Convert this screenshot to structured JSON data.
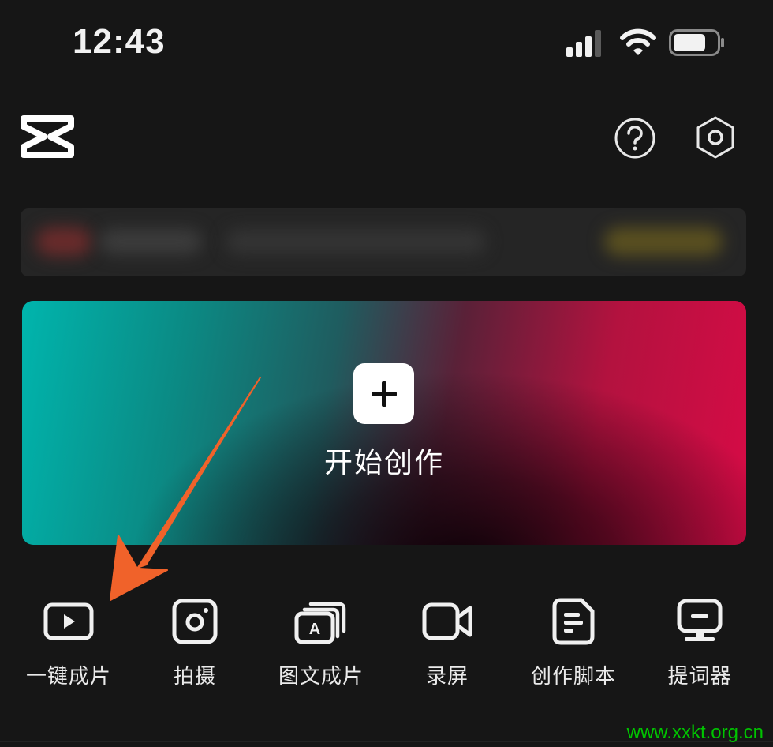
{
  "status_bar": {
    "time": "12:43",
    "icons": [
      "signal-icon",
      "wifi-icon",
      "battery-icon"
    ]
  },
  "header": {
    "logo": "capcut-logo",
    "actions": [
      "help-icon",
      "settings-icon"
    ]
  },
  "hero": {
    "label": "开始创作",
    "icon": "plus-icon",
    "gradient_colors": [
      "#00b5ad",
      "#1f5c5f",
      "#0a0006",
      "#d70b46"
    ]
  },
  "tools": [
    {
      "label": "一键成片",
      "icon": "play-video-icon"
    },
    {
      "label": "拍摄",
      "icon": "camera-icon"
    },
    {
      "label": "图文成片",
      "icon": "text-to-video-icon"
    },
    {
      "label": "录屏",
      "icon": "video-record-icon"
    },
    {
      "label": "创作脚本",
      "icon": "script-document-icon"
    },
    {
      "label": "提词器",
      "icon": "teleprompter-icon"
    }
  ],
  "annotation": {
    "color": "#f0622a"
  },
  "watermark": "www.xxkt.org.cn"
}
